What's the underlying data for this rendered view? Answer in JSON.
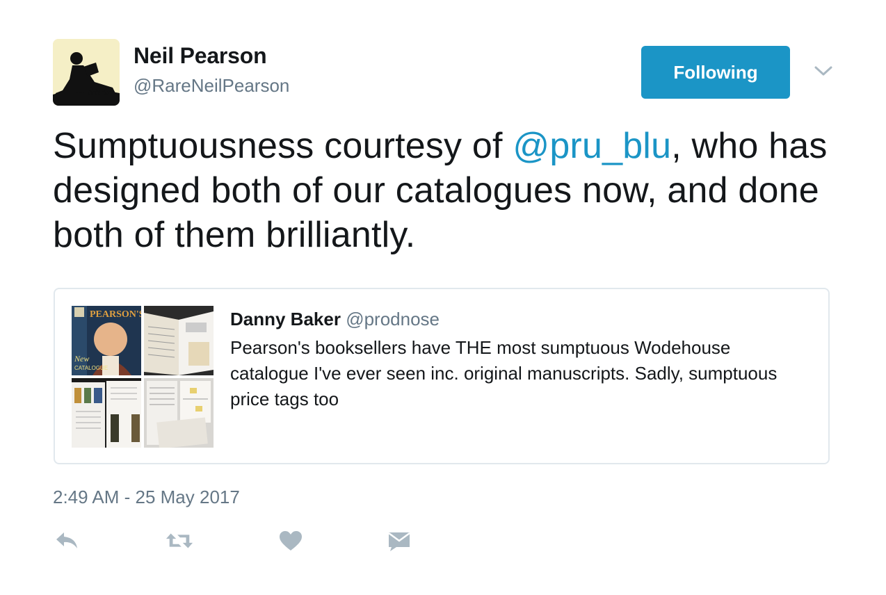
{
  "author": {
    "name": "Neil Pearson",
    "handle": "@RareNeilPearson",
    "avatar_icon": "silhouette-reading-avatar"
  },
  "follow_button": {
    "label": "Following",
    "color": "#1b95c6"
  },
  "tweet": {
    "text_before": "Sumptuousness courtesy of ",
    "mention": "@pru_blu",
    "text_after": ", who has designed both of our catalogues now, and done both of them brilliantly."
  },
  "quoted_tweet": {
    "name": "Danny Baker",
    "handle": "@prodnose",
    "text": "Pearson's booksellers have THE most sumptuous Wodehouse catalogue I've ever seen inc. original manuscripts. Sadly, sumptuous price tags too",
    "cover_text": {
      "brand": "PEARSON'S",
      "line1": "New",
      "line2": "CATALOGUE"
    }
  },
  "timestamp": "2:49 AM - 25 May 2017",
  "actions": [
    {
      "icon": "reply-icon"
    },
    {
      "icon": "retweet-icon"
    },
    {
      "icon": "like-icon"
    },
    {
      "icon": "direct-message-icon"
    }
  ],
  "colors": {
    "link": "#1b95c6",
    "secondary_text": "#657786",
    "action_icon": "#aab8c2",
    "border": "#e1e8ed"
  }
}
